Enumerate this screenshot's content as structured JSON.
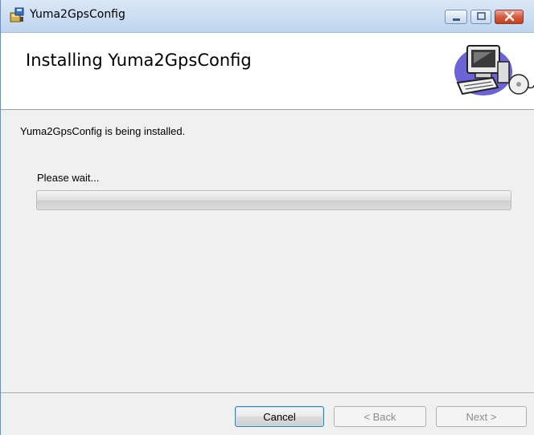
{
  "window": {
    "title": "Yuma2GpsConfig"
  },
  "banner": {
    "title": "Installing Yuma2GpsConfig"
  },
  "body": {
    "status": "Yuma2GpsConfig is being installed.",
    "wait_label": "Please wait...",
    "progress": 0
  },
  "buttons": {
    "cancel": "Cancel",
    "back": "< Back",
    "next": "Next >"
  },
  "icons": {
    "app": "installer-icon",
    "banner": "computer-setup-icon"
  }
}
